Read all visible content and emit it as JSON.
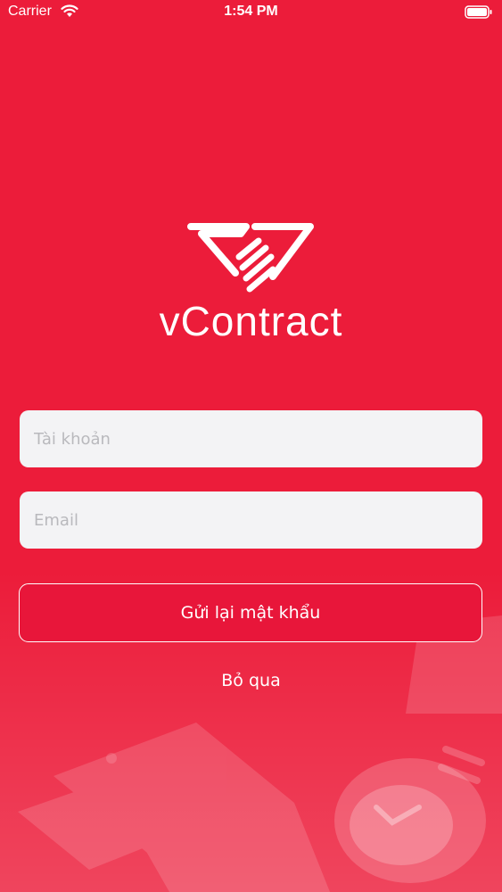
{
  "status_bar": {
    "carrier": "Carrier",
    "time": "1:54 PM"
  },
  "logo": {
    "text": "vContract"
  },
  "form": {
    "username_placeholder": "Tài khoản",
    "email_placeholder": "Email",
    "submit_label": "Gửi lại mật khẩu",
    "skip_label": "Bỏ qua"
  },
  "colors": {
    "background": "#ec1c3a",
    "field_background": "#f3f3f5",
    "button_background": "#e8163a",
    "text": "#ffffff"
  }
}
